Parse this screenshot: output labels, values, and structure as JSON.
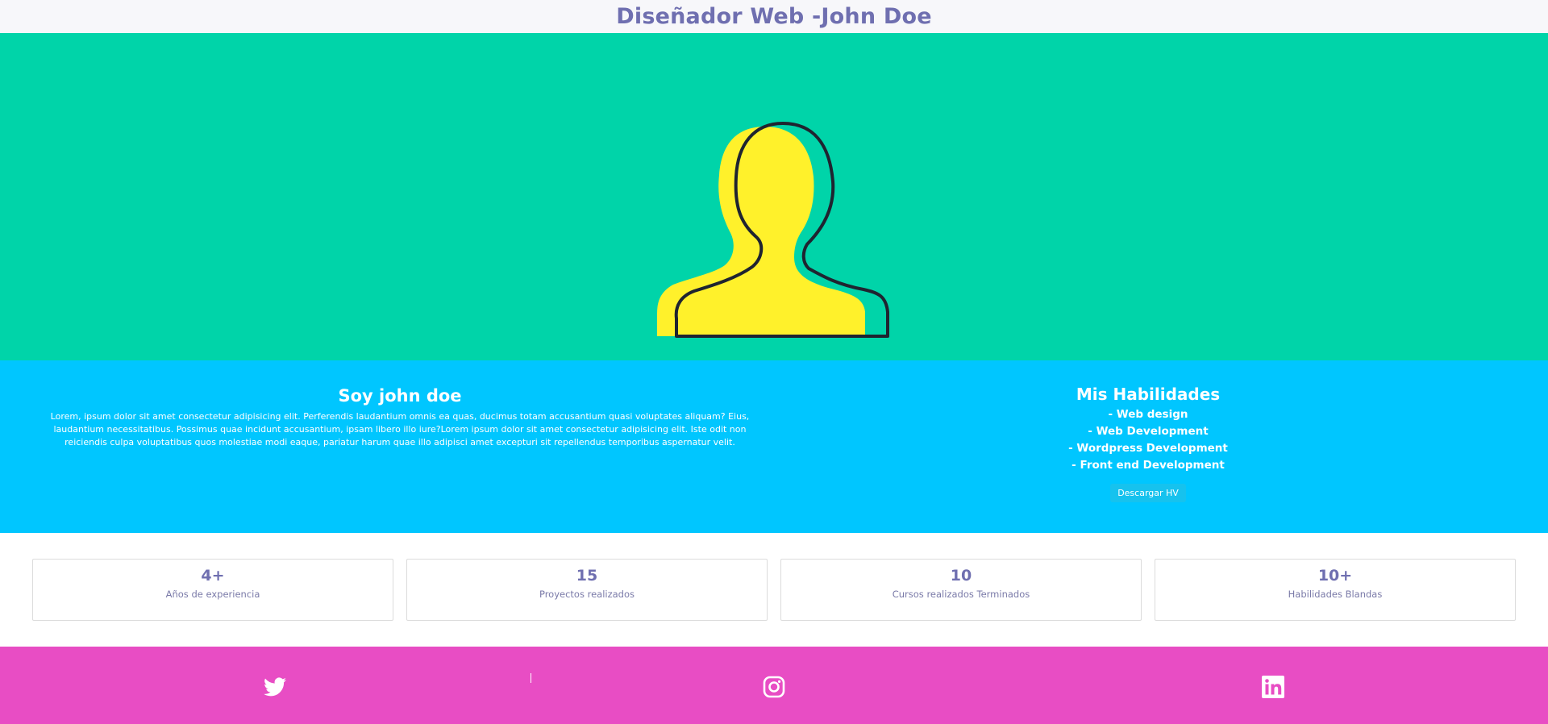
{
  "header": {
    "title": "Diseñador Web -John Doe"
  },
  "about": {
    "heading": "Soy john doe",
    "text": "Lorem, ipsum dolor sit amet consectetur adipisicing elit. Perferendis laudantium omnis ea quas, ducimus totam accusantium quasi voluptates aliquam? Eius, laudantium necessitatibus. Possimus quae incidunt accusantium, ipsam libero illo iure?Lorem ipsum dolor sit amet consectetur adipisicing elit. Iste odit non reiciendis culpa voluptatibus quos molestiae modi eaque, pariatur harum quae illo adipisci amet excepturi sit repellendus temporibus aspernatur velit."
  },
  "skills": {
    "heading": "Mis Habilidades",
    "items": [
      "- Web design",
      "- Web Development",
      "- Wordpress Development",
      "- Front end Development"
    ],
    "download_label": "Descargar HV"
  },
  "stats": [
    {
      "value": "4+",
      "label": "Años de experiencia"
    },
    {
      "value": "15",
      "label": "Proyectos realizados"
    },
    {
      "value": "10",
      "label": "Cursos realizados Terminados"
    },
    {
      "value": "10+",
      "label": "Habilidades Blandas"
    }
  ],
  "social": [
    {
      "icon": "twitter-icon"
    },
    {
      "icon": "instagram-icon"
    },
    {
      "icon": "linkedin-icon"
    }
  ],
  "colors": {
    "header_bg": "#f7f7fa",
    "title": "#6f6fb0",
    "hero_bg": "#00d4a9",
    "avatar_fill": "#fff12b",
    "about_bg": "#00c6ff",
    "footer_bg": "#e84dc4"
  }
}
